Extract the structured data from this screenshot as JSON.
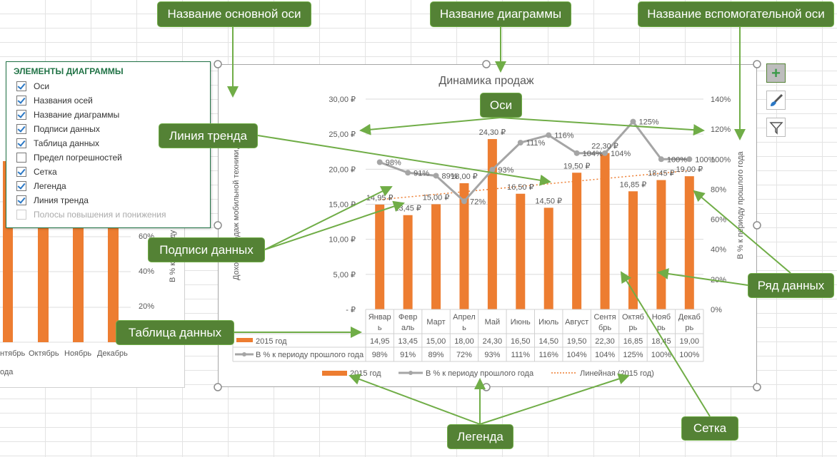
{
  "panel": {
    "title": "ЭЛЕМЕНТЫ ДИАГРАММЫ",
    "items": [
      {
        "label": "Оси",
        "checked": true
      },
      {
        "label": "Названия осей",
        "checked": true
      },
      {
        "label": "Название диаграммы",
        "checked": true
      },
      {
        "label": "Подписи данных",
        "checked": true
      },
      {
        "label": "Таблица данных",
        "checked": true
      },
      {
        "label": "Предел погрешностей",
        "checked": false
      },
      {
        "label": "Сетка",
        "checked": true
      },
      {
        "label": "Легенда",
        "checked": true
      },
      {
        "label": "Линия тренда",
        "checked": true
      },
      {
        "label": "Полосы повышения и понижения",
        "checked": false,
        "disabled": true
      }
    ]
  },
  "background_chart": {
    "x_labels": [
      "нтябрь",
      "Октябрь",
      "Ноябрь",
      "Декабрь"
    ],
    "y_labels": [
      "60%",
      "40%",
      "20%"
    ],
    "axis_title": "В % к периоду прошлого года",
    "legend_fragment": "ода"
  },
  "callouts": {
    "primary_axis_title": "Название основной оси",
    "chart_title": "Название диаграммы",
    "secondary_axis_title": "Название вспомогательной оси",
    "axes": "Оси",
    "trendline": "Линия тренда",
    "data_labels": "Подписи данных",
    "data_table": "Таблица данных",
    "data_series": "Ряд данных",
    "legend": "Легенда",
    "grid": "Сетка"
  },
  "toolbar": {
    "icons": [
      "plus-icon",
      "brush-icon",
      "filter-icon"
    ]
  },
  "colors": {
    "bar": "#ed7d31",
    "line": "#a5a5a5",
    "callout": "#548235"
  },
  "chart_data": {
    "type": "bar+line",
    "title": "Динамика продаж",
    "ylabel": "Доход с продаж мобильной техники, руб.",
    "y2label": "В % к периоду прошлого года",
    "ylim": [
      0,
      30
    ],
    "y2lim": [
      0,
      1.4
    ],
    "y_ticks": [
      "-  ₽",
      "5,00 ₽",
      "10,00 ₽",
      "15,00 ₽",
      "20,00 ₽",
      "25,00 ₽",
      "30,00 ₽"
    ],
    "y2_ticks": [
      "0%",
      "20%",
      "40%",
      "60%",
      "80%",
      "100%",
      "120%",
      "140%"
    ],
    "categories": [
      "Январь",
      "Февраль",
      "Март",
      "Апрель",
      "Май",
      "Июнь",
      "Июль",
      "Август",
      "Сентябрь",
      "Октябрь",
      "Ноябрь",
      "Декабрь"
    ],
    "table_headers": [
      "Январ ь",
      "Февр аль",
      "Март",
      "Апрел ь",
      "Май",
      "Июнь",
      "Июль",
      "Август",
      "Сентя брь",
      "Октяб рь",
      "Нояб рь",
      "Декаб рь"
    ],
    "series": [
      {
        "name": "2015 год",
        "type": "bar",
        "values": [
          14.95,
          13.45,
          15.0,
          18.0,
          24.3,
          16.5,
          14.5,
          19.5,
          22.3,
          16.85,
          18.45,
          19.0
        ],
        "labels": [
          "14,95 ₽",
          "13,45 ₽",
          "15,00 ₽",
          "18,00 ₽",
          "24,30 ₽",
          "16,50 ₽",
          "14,50 ₽",
          "19,50 ₽",
          "22,30 ₽",
          "16,85 ₽",
          "18,45 ₽",
          "19,00 ₽"
        ],
        "table": [
          "14,95",
          "13,45",
          "15,00",
          "18,00",
          "24,30",
          "16,50",
          "14,50",
          "19,50",
          "22,30",
          "16,85",
          "18,45",
          "19,00"
        ]
      },
      {
        "name": "В % к периоду прошлого года",
        "type": "line",
        "axis": "secondary",
        "values": [
          0.98,
          0.91,
          0.89,
          0.72,
          0.93,
          1.11,
          1.16,
          1.04,
          1.04,
          1.25,
          1.0,
          1.0
        ],
        "labels": [
          "98%",
          "91%",
          "89%",
          "72%",
          "93%",
          "111%",
          "116%",
          "104%",
          "104%",
          "125%",
          "100%",
          "100%"
        ]
      }
    ],
    "trendline": {
      "name": "Линейная (2015 год)",
      "type": "linear",
      "of": "2015 год"
    },
    "grid": true,
    "legend": "bottom"
  }
}
